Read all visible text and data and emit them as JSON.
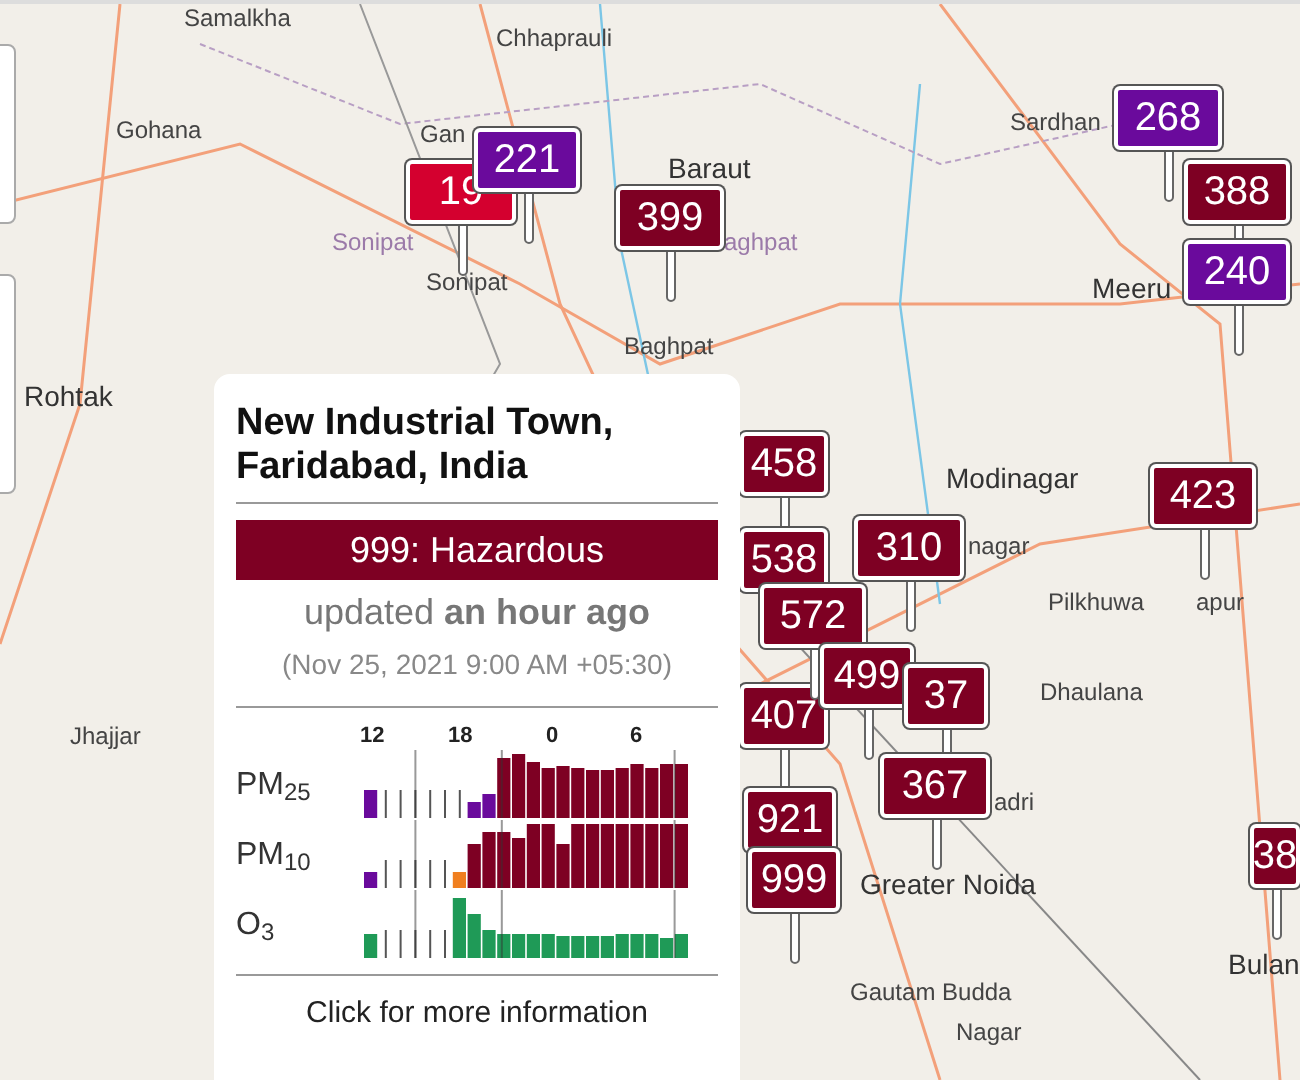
{
  "map": {
    "places": [
      {
        "name": "Samalkha",
        "kind": "town"
      },
      {
        "name": "Chhaprauli",
        "kind": "town"
      },
      {
        "name": "Gohana",
        "kind": "town"
      },
      {
        "name": "Gan",
        "kind": "town"
      },
      {
        "name": "Baraut",
        "kind": "city"
      },
      {
        "name": "Sonipat",
        "kind": "district"
      },
      {
        "name": "Sonipat",
        "kind": "town"
      },
      {
        "name": "aghpat",
        "kind": "district"
      },
      {
        "name": "Baghpat",
        "kind": "town"
      },
      {
        "name": "Sardhan",
        "kind": "town"
      },
      {
        "name": "Meeru",
        "kind": "city"
      },
      {
        "name": "Rohtak",
        "kind": "city"
      },
      {
        "name": "Modinagar",
        "kind": "city"
      },
      {
        "name": "nagar",
        "kind": "town"
      },
      {
        "name": "Pilkhuwa",
        "kind": "town"
      },
      {
        "name": "apur",
        "kind": "town"
      },
      {
        "name": "Dhaulana",
        "kind": "town"
      },
      {
        "name": "adri",
        "kind": "town"
      },
      {
        "name": "Greater Noida",
        "kind": "city"
      },
      {
        "name": "Gautam Budda",
        "kind": "town"
      },
      {
        "name": "Nagar",
        "kind": "town"
      },
      {
        "name": "Bulan",
        "kind": "city"
      },
      {
        "name": "Jhajjar",
        "kind": "town"
      }
    ],
    "markers": [
      {
        "aqi": "19",
        "color": "#d4002f"
      },
      {
        "aqi": "221",
        "color": "#6a0a9c"
      },
      {
        "aqi": "399",
        "color": "#7e0023"
      },
      {
        "aqi": "268",
        "color": "#6a0a9c"
      },
      {
        "aqi": "388",
        "color": "#7e0023"
      },
      {
        "aqi": "240",
        "color": "#6a0a9c"
      },
      {
        "aqi": "423",
        "color": "#7e0023"
      },
      {
        "aqi": "458",
        "color": "#7e0023"
      },
      {
        "aqi": "310",
        "color": "#7e0023"
      },
      {
        "aqi": "538",
        "color": "#7e0023"
      },
      {
        "aqi": "407",
        "color": "#7e0023"
      },
      {
        "aqi": "572",
        "color": "#7e0023"
      },
      {
        "aqi": "499",
        "color": "#7e0023"
      },
      {
        "aqi": "37",
        "color": "#7e0023"
      },
      {
        "aqi": "367",
        "color": "#7e0023"
      },
      {
        "aqi": "921",
        "color": "#7e0023"
      },
      {
        "aqi": "999",
        "color": "#7e0023"
      },
      {
        "aqi": "38",
        "color": "#7e0023"
      }
    ]
  },
  "popup": {
    "title": "New Industrial Town, Faridabad, India",
    "aqi_status": "999: Hazardous",
    "color": "#7e0023",
    "updated": "updated **an hour ago**",
    "timestamp": "(Nov 25, 2021 9:00 AM +05:30)",
    "hour_labels": [
      "12",
      "18",
      "0",
      "6"
    ],
    "pollutants": [
      {
        "label": "PM$_{25}$",
        "kind": "pm25"
      },
      {
        "label": "PM$_{10}$",
        "kind": "pm10"
      },
      {
        "label": "O$_{3}$",
        "kind": "o3"
      }
    ],
    "link": "Click for more information"
  }
}
